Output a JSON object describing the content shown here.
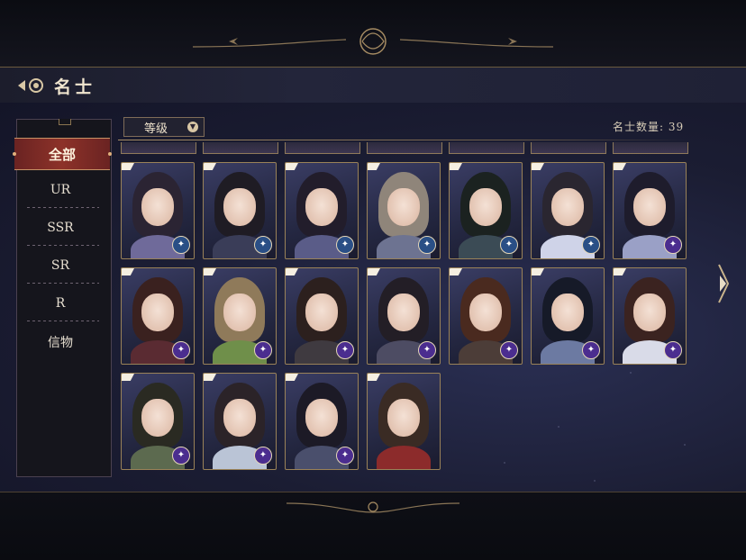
{
  "header": {
    "title": "名士"
  },
  "sidebar": {
    "items": [
      {
        "label": "全部",
        "active": true
      },
      {
        "label": "UR"
      },
      {
        "label": "SSR"
      },
      {
        "label": "SR"
      },
      {
        "label": "R"
      },
      {
        "label": "信物"
      }
    ]
  },
  "toolbar": {
    "sort_label": "等级",
    "sort_icon": "chevron-down-icon"
  },
  "count": {
    "text": "名士数量: 39"
  },
  "colors": {
    "accent_red": "#8d3229",
    "gold": "#c79266",
    "badge_blue": "#2a4f86",
    "badge_purple": "#4b2d8f"
  },
  "cards": [
    {
      "hair": "#2b2433",
      "body": "#6f6a9a",
      "badge": "blue"
    },
    {
      "hair": "#1f1c24",
      "body": "#3a3d58",
      "badge": "blue"
    },
    {
      "hair": "#221d2b",
      "body": "#5a5c88",
      "badge": "blue"
    },
    {
      "hair": "#8f857a",
      "body": "#6d7391",
      "badge": "blue"
    },
    {
      "hair": "#1b2220",
      "body": "#3b4b55",
      "badge": "blue"
    },
    {
      "hair": "#2a2630",
      "body": "#cfd3e8",
      "badge": "blue"
    },
    {
      "hair": "#1e1c2c",
      "body": "#9aa0c6",
      "badge": "purple"
    },
    {
      "hair": "#3a211f",
      "body": "#5a2b32",
      "badge": "purple"
    },
    {
      "hair": "#8f7a5a",
      "body": "#6f8f4a",
      "badge": "purple"
    },
    {
      "hair": "#2c201e",
      "body": "#3f3a40",
      "badge": "purple"
    },
    {
      "hair": "#231e26",
      "body": "#4d4c63",
      "badge": "purple"
    },
    {
      "hair": "#4a2a1f",
      "body": "#4c3d38",
      "badge": "purple"
    },
    {
      "hair": "#161a28",
      "body": "#6c7aa2",
      "badge": "purple"
    },
    {
      "hair": "#3b2320",
      "body": "#d9dbe8",
      "badge": "purple"
    },
    {
      "hair": "#2a2a22",
      "body": "#5c6a4f",
      "badge": "purple"
    },
    {
      "hair": "#2b2328",
      "body": "#bac4d6",
      "badge": "purple"
    },
    {
      "hair": "#1c1a26",
      "body": "#4a4f6c",
      "badge": "purple"
    },
    {
      "hair": "#3a2b24",
      "body": "#8c2b2b",
      "badge": "none"
    }
  ]
}
